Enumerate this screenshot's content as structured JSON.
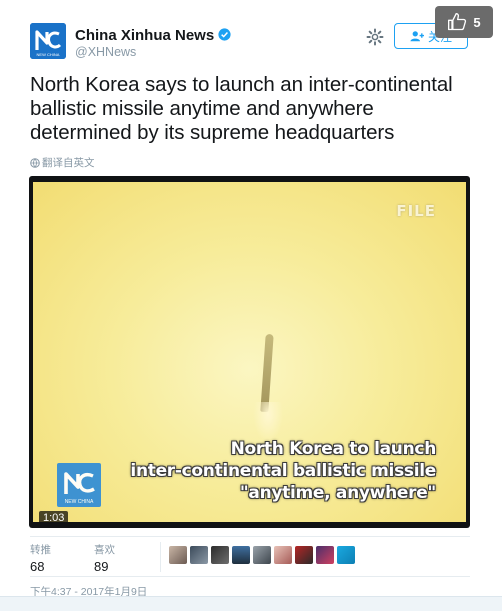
{
  "account": {
    "display_name": "China Xinhua News",
    "handle": "@XHNews",
    "avatar_text": "NEW CHINA",
    "verified": true
  },
  "actions": {
    "follow_label": "关注",
    "like_count": "5"
  },
  "tweet": {
    "text": "North Korea says to launch an inter-continental ballistic missile anytime and anywhere determined by its supreme headquarters",
    "translate_label": "翻译自英文"
  },
  "video": {
    "file_tag": "FILE",
    "caption_lines": [
      "North Korea to launch",
      "inter-continental ballistic missile",
      "\"anytime, anywhere\""
    ],
    "logo_text": "NEW CHINA",
    "duration": "1:03"
  },
  "stats": {
    "retweets_label": "转推",
    "retweets": "68",
    "likes_label": "喜欢",
    "likes": "89",
    "liker_avatar_count": 9
  },
  "timestamp": "下午4:37 - 2017年1月9日",
  "colors": {
    "accent": "#1da1f2",
    "avatar_bg": "#1a72c8",
    "muted": "#8899a6"
  }
}
